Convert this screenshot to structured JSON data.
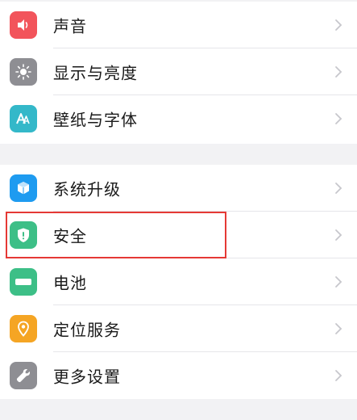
{
  "settings": {
    "group1": [
      {
        "label": "声音",
        "icon": "speaker-icon",
        "color": "#f2545b"
      },
      {
        "label": "显示与亮度",
        "icon": "brightness-icon",
        "color": "#8e8e93"
      },
      {
        "label": "壁纸与字体",
        "icon": "font-icon",
        "color": "#34b8c9"
      }
    ],
    "group2": [
      {
        "label": "系统升级",
        "icon": "system-update-icon",
        "color": "#1e9bf0"
      },
      {
        "label": "安全",
        "icon": "shield-icon",
        "color": "#3dbf87"
      },
      {
        "label": "电池",
        "icon": "battery-icon",
        "color": "#3dbf87"
      },
      {
        "label": "定位服务",
        "icon": "location-icon",
        "color": "#f5a524"
      },
      {
        "label": "更多设置",
        "icon": "wrench-icon",
        "color": "#8e8e93"
      }
    ]
  },
  "highlight": {
    "target": "安全",
    "color": "#e53935"
  }
}
